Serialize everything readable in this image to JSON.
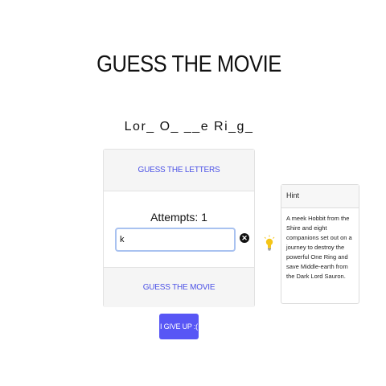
{
  "header": {
    "title": "GUESS THE MOVIE"
  },
  "puzzle": {
    "masked_title": "Lor_ O_ __e Ri_g_"
  },
  "game": {
    "guess_letters_label": "GUESS THE LETTERS",
    "attempts_text": "Attempts: 1",
    "guess_input_value": "k",
    "guess_movie_label": "GUESS THE MOVIE",
    "clear_icon": "close-icon"
  },
  "hint": {
    "icon": "lightbulb-icon",
    "header": "Hint",
    "text": "A meek Hobbit from the Shire and eight companions set out on a journey to destroy the powerful One Ring and save Middle-earth from the Dark Lord Sauron."
  },
  "actions": {
    "give_up_label": "I GIVE UP :("
  },
  "colors": {
    "accent": "#5856f5",
    "link": "#4c52e6",
    "input_focus_border": "#a9c2f0",
    "bulb": "#f5c518"
  }
}
